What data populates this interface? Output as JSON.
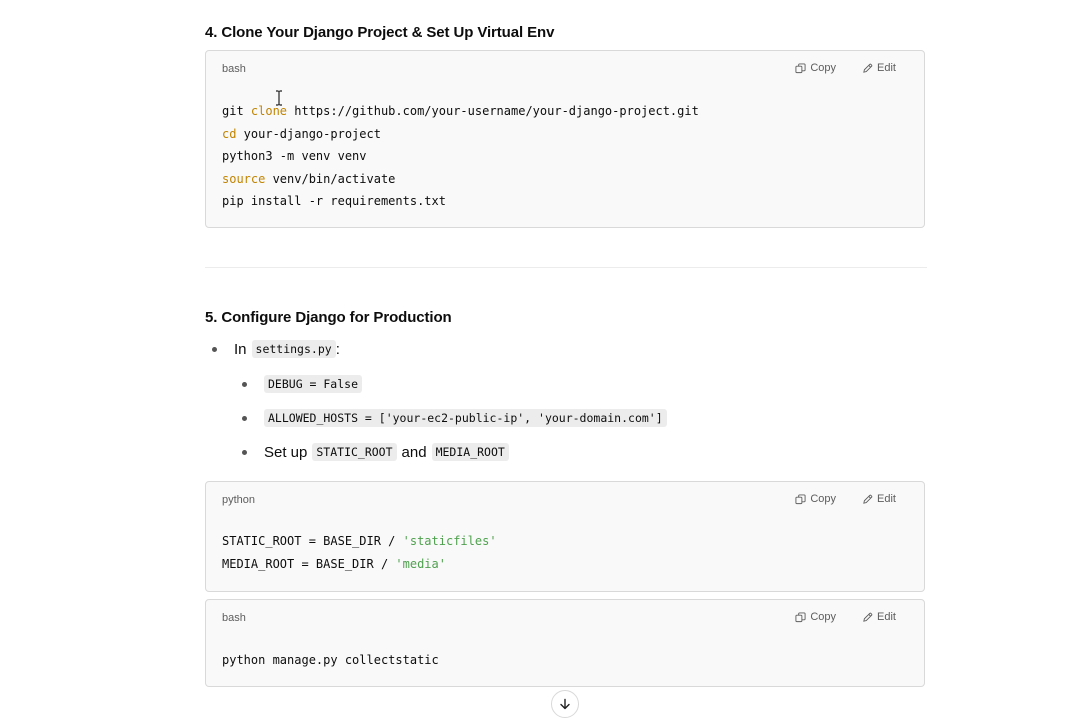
{
  "section4": {
    "heading": "4. Clone Your Django Project & Set Up Virtual Env",
    "code_block": {
      "language": "bash",
      "copy_label": "Copy",
      "edit_label": "Edit",
      "lines": [
        {
          "kw": "",
          "pre": "git ",
          "kw2": "clone",
          "rest": " https://github.com/your-username/your-django-project.git"
        },
        {
          "kw": "cd",
          "rest": " your-django-project"
        },
        {
          "kw": "",
          "rest": "python3 -m venv venv"
        },
        {
          "kw": "source",
          "rest": " venv/bin/activate"
        },
        {
          "kw": "",
          "rest": "pip install -r requirements.txt"
        }
      ]
    }
  },
  "section5": {
    "heading": "5. Configure Django for Production",
    "bullet_in": {
      "text": "In",
      "code": "settings.py",
      "suffix": ":"
    },
    "sub_bullets": {
      "debug_code": "DEBUG = False",
      "allowed_hosts_code": "ALLOWED_HOSTS = ['your-ec2-public-ip', 'your-domain.com']",
      "setup_text": "Set up",
      "static_root_code": "STATIC_ROOT",
      "and_text": "and",
      "media_root_code": "MEDIA_ROOT"
    },
    "python_block": {
      "language": "python",
      "copy_label": "Copy",
      "edit_label": "Edit",
      "line1_pre": "STATIC_ROOT = BASE_DIR / ",
      "line1_str": "'staticfiles'",
      "line2_pre": "MEDIA_ROOT = BASE_DIR / ",
      "line2_str": "'media'"
    },
    "bash_block": {
      "language": "bash",
      "copy_label": "Copy",
      "edit_label": "Edit",
      "line1": "python manage.py collectstatic"
    }
  },
  "icons": {
    "copy": "copy-icon",
    "edit": "edit-icon",
    "scroll_down": "arrow-down-icon"
  },
  "colors": {
    "keyword": "#c18401",
    "string": "#50a14f",
    "code_bg": "#f9f9f9",
    "inline_code_bg": "#ececec"
  }
}
